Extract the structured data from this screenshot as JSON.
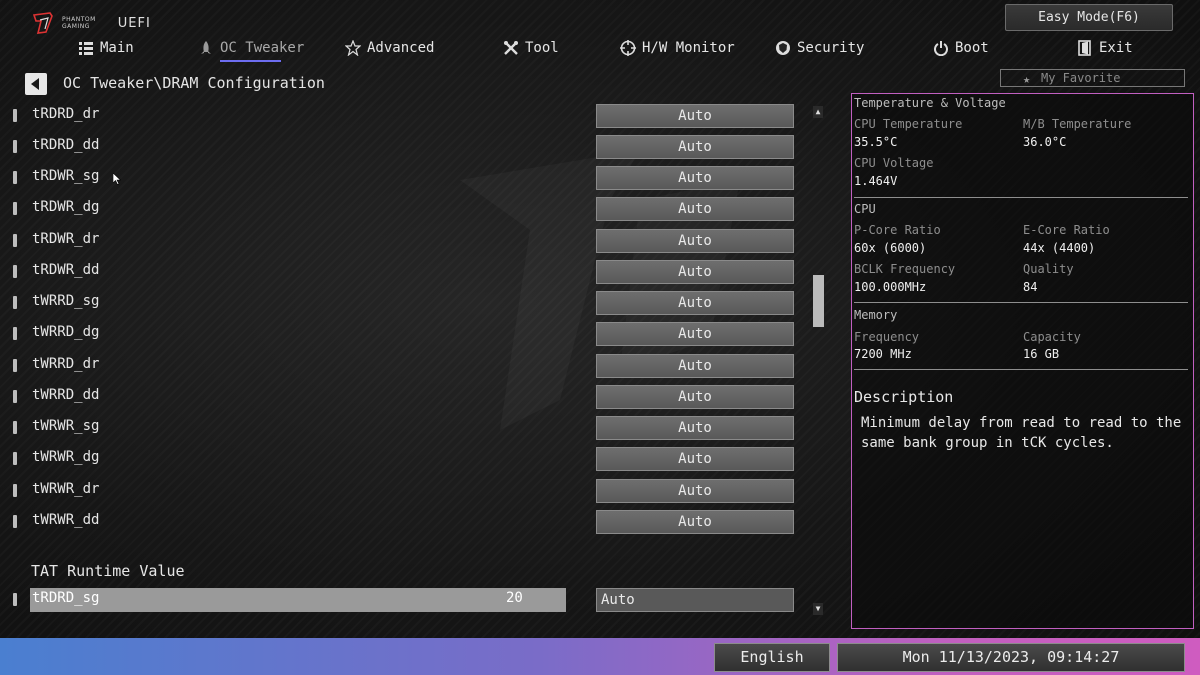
{
  "brand": {
    "line1": "PHANTOM",
    "line2": "GAMING",
    "uefi": "UEFI"
  },
  "easy_mode": "Easy Mode(F6)",
  "nav": {
    "main": "Main",
    "oc_tweaker": "OC Tweaker",
    "advanced": "Advanced",
    "tool": "Tool",
    "hw_monitor": "H/W Monitor",
    "security": "Security",
    "boot": "Boot",
    "exit": "Exit"
  },
  "breadcrumb": "OC Tweaker\\DRAM Configuration",
  "favorite": "My Favorite",
  "settings": [
    {
      "label": "tRDRD_dr",
      "value": "Auto"
    },
    {
      "label": "tRDRD_dd",
      "value": "Auto"
    },
    {
      "label": "tRDWR_sg",
      "value": "Auto"
    },
    {
      "label": "tRDWR_dg",
      "value": "Auto"
    },
    {
      "label": "tRDWR_dr",
      "value": "Auto"
    },
    {
      "label": "tRDWR_dd",
      "value": "Auto"
    },
    {
      "label": "tWRRD_sg",
      "value": "Auto"
    },
    {
      "label": "tWRRD_dg",
      "value": "Auto"
    },
    {
      "label": "tWRRD_dr",
      "value": "Auto"
    },
    {
      "label": "tWRRD_dd",
      "value": "Auto"
    },
    {
      "label": "tWRWR_sg",
      "value": "Auto"
    },
    {
      "label": "tWRWR_dg",
      "value": "Auto"
    },
    {
      "label": "tWRWR_dr",
      "value": "Auto"
    },
    {
      "label": "tWRWR_dd",
      "value": "Auto"
    }
  ],
  "tat": {
    "title": "TAT Runtime Value",
    "selected": {
      "label": "tRDRD_sg",
      "runtime": "20",
      "value": "Auto"
    }
  },
  "panel": {
    "temp_voltage": {
      "header": "Temperature & Voltage",
      "cpu_temp_label": "CPU Temperature",
      "cpu_temp": "35.5°C",
      "mb_temp_label": "M/B Temperature",
      "mb_temp": "36.0°C",
      "cpu_voltage_label": "CPU Voltage",
      "cpu_voltage": "1.464V"
    },
    "cpu": {
      "header": "CPU",
      "pcore_label": "P-Core Ratio",
      "pcore": "60x (6000)",
      "ecore_label": "E-Core Ratio",
      "ecore": "44x (4400)",
      "bclk_label": "BCLK Frequency",
      "bclk": "100.000MHz",
      "quality_label": "Quality",
      "quality": "84"
    },
    "memory": {
      "header": "Memory",
      "freq_label": "Frequency",
      "freq": "7200 MHz",
      "capacity_label": "Capacity",
      "capacity": "16 GB"
    },
    "description": {
      "title": "Description",
      "text": "Minimum delay from read to read to the same bank group in tCK cycles."
    }
  },
  "footer": {
    "language": "English",
    "datetime": "Mon 11/13/2023, 09:14:27"
  },
  "colors": {
    "accent_underline": "#6d6df0",
    "panel_border": "#c15fc1",
    "bar_left": "#4a7fd0",
    "bar_right": "#cf5cc0"
  }
}
